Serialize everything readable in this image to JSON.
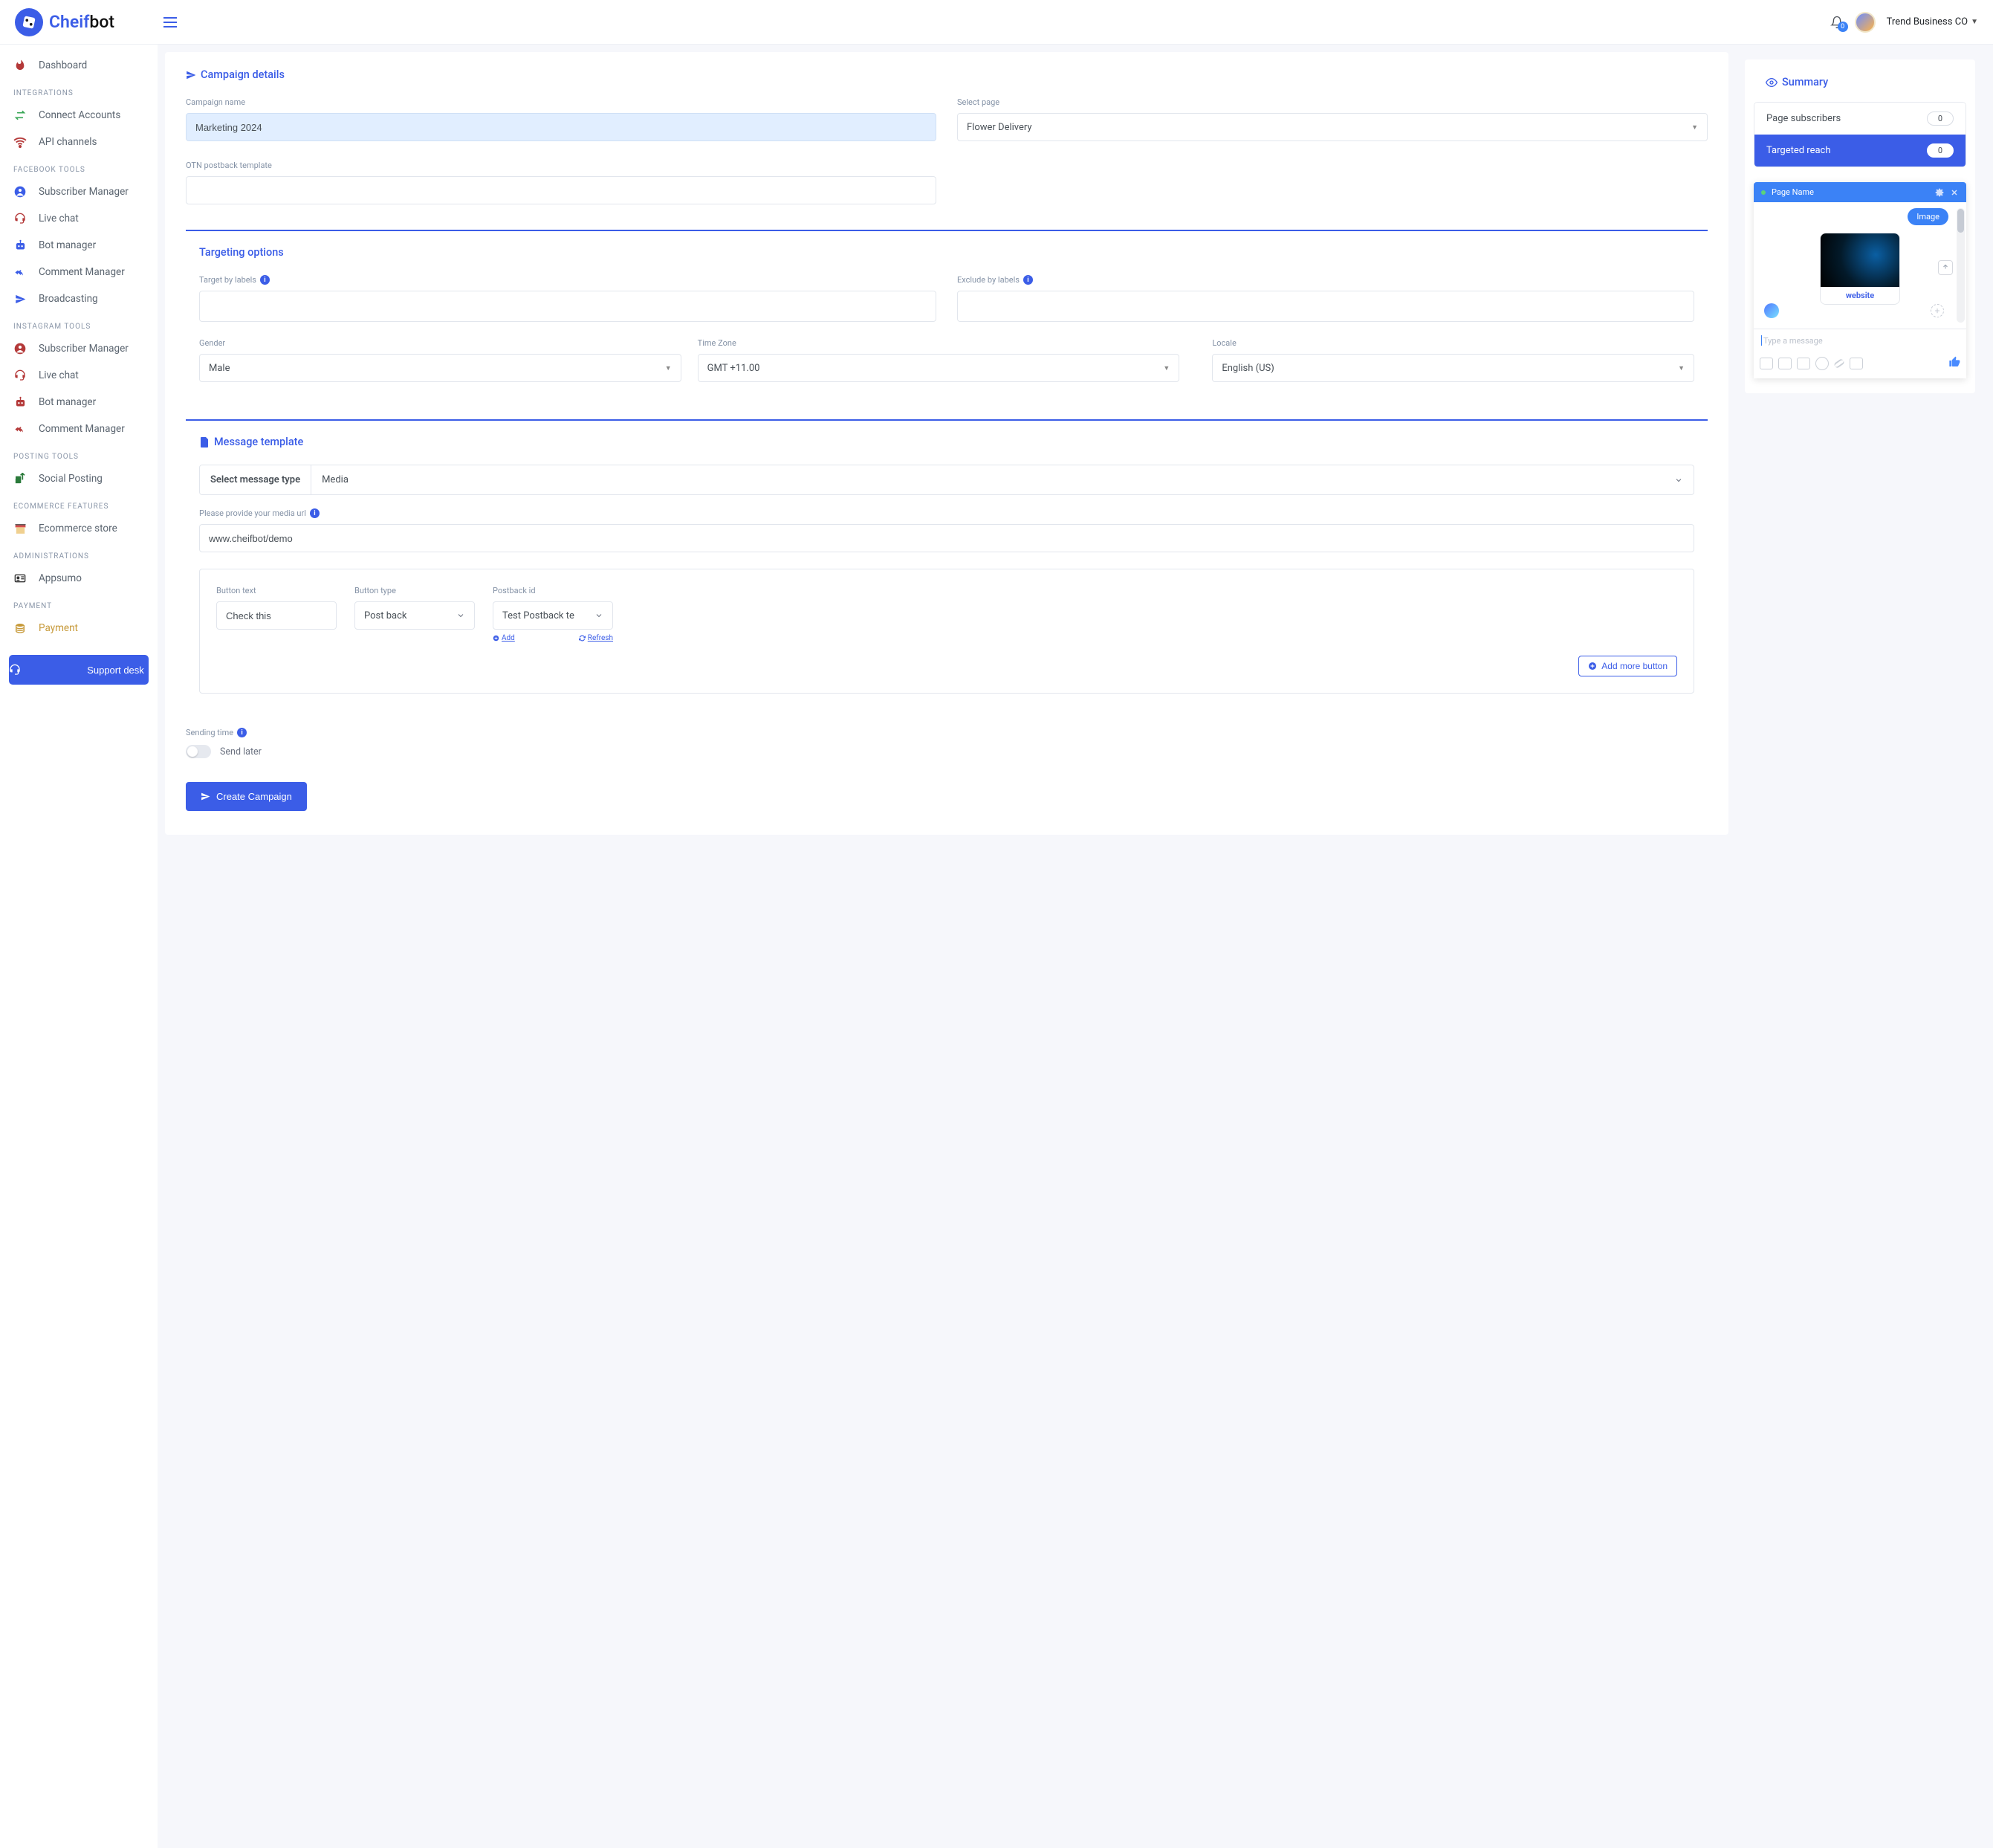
{
  "brand": {
    "pre": "Cheif",
    "post": "bot"
  },
  "topbar": {
    "user": "Trend Business CO",
    "bell_count": "0"
  },
  "sidebar": {
    "support": "Support desk",
    "sections": [
      {
        "type": "item",
        "icon": "fire",
        "label": "Dashboard",
        "color": "#b43939"
      },
      {
        "type": "section",
        "label": "Integrations"
      },
      {
        "type": "item",
        "icon": "exchange",
        "label": "Connect Accounts",
        "color": "#3aa757"
      },
      {
        "type": "item",
        "icon": "wifi",
        "label": "API channels",
        "color": "#b43939"
      },
      {
        "type": "section",
        "label": "Facebook Tools"
      },
      {
        "type": "item",
        "icon": "user-circle",
        "label": "Subscriber Manager",
        "color": "#3b5de7"
      },
      {
        "type": "item",
        "icon": "headset",
        "label": "Live chat",
        "color": "#b43939"
      },
      {
        "type": "item",
        "icon": "robot",
        "label": "Bot manager",
        "color": "#3b5de7"
      },
      {
        "type": "item",
        "icon": "reply-all",
        "label": "Comment Manager",
        "color": "#3b5de7"
      },
      {
        "type": "item",
        "icon": "paper-plane",
        "label": "Broadcasting",
        "color": "#3b5de7"
      },
      {
        "type": "section",
        "label": "Instagram Tools"
      },
      {
        "type": "item",
        "icon": "user-circle",
        "label": "Subscriber Manager",
        "color": "#b43939"
      },
      {
        "type": "item",
        "icon": "headset",
        "label": "Live chat",
        "color": "#b43939"
      },
      {
        "type": "item",
        "icon": "robot",
        "label": "Bot manager",
        "color": "#b43939"
      },
      {
        "type": "item",
        "icon": "reply-all",
        "label": "Comment Manager",
        "color": "#b43939"
      },
      {
        "type": "section",
        "label": "Posting Tools"
      },
      {
        "type": "item",
        "icon": "share",
        "label": "Social Posting",
        "color": "#2a7a3a"
      },
      {
        "type": "section",
        "label": "Ecommerce Features"
      },
      {
        "type": "item",
        "icon": "store",
        "label": "Ecommerce store",
        "color": "#b43939"
      },
      {
        "type": "section",
        "label": "Administrations"
      },
      {
        "type": "item",
        "icon": "id-card",
        "label": "Appsumo",
        "color": "#333"
      },
      {
        "type": "section",
        "label": "Payment"
      },
      {
        "type": "item",
        "icon": "coins",
        "label": "Payment",
        "color": "#c79a3a",
        "cls": "pay"
      }
    ]
  },
  "campaign": {
    "title": "Campaign details",
    "name_label": "Campaign name",
    "name_value": "Marketing 2024",
    "page_label": "Select page",
    "page_value": "Flower Delivery",
    "otn_label": "OTN postback template"
  },
  "targeting": {
    "title": "Targeting options",
    "target_label": "Target by labels",
    "exclude_label": "Exclude by labels",
    "gender_label": "Gender",
    "gender_value": "Male",
    "tz_label": "Time Zone",
    "tz_value": "GMT +11.00",
    "locale_label": "Locale",
    "locale_value": "English (US)"
  },
  "message": {
    "title": "Message template",
    "type_label": "Select message type",
    "type_value": "Media",
    "media_label": "Please provide your media url",
    "media_value": "www.cheifbot/demo",
    "btn_text_label": "Button text",
    "btn_text_value": "Check this",
    "btn_type_label": "Button type",
    "btn_type_value": "Post back",
    "postback_label": "Postback id",
    "postback_value": "Test Postback te",
    "add_link": "Add",
    "refresh_link": "Refresh",
    "add_more": "Add more button"
  },
  "sending": {
    "label": "Sending time",
    "later": "Send later",
    "create": "Create Campaign"
  },
  "summary": {
    "title": "Summary",
    "rows": [
      {
        "label": "Page subscribers",
        "value": "0",
        "cls": "white"
      },
      {
        "label": "Targeted reach",
        "value": "0",
        "cls": "blue"
      }
    ]
  },
  "preview": {
    "page_name": "Page Name",
    "chip": "Image",
    "link": "website",
    "placeholder": "Type a message"
  }
}
